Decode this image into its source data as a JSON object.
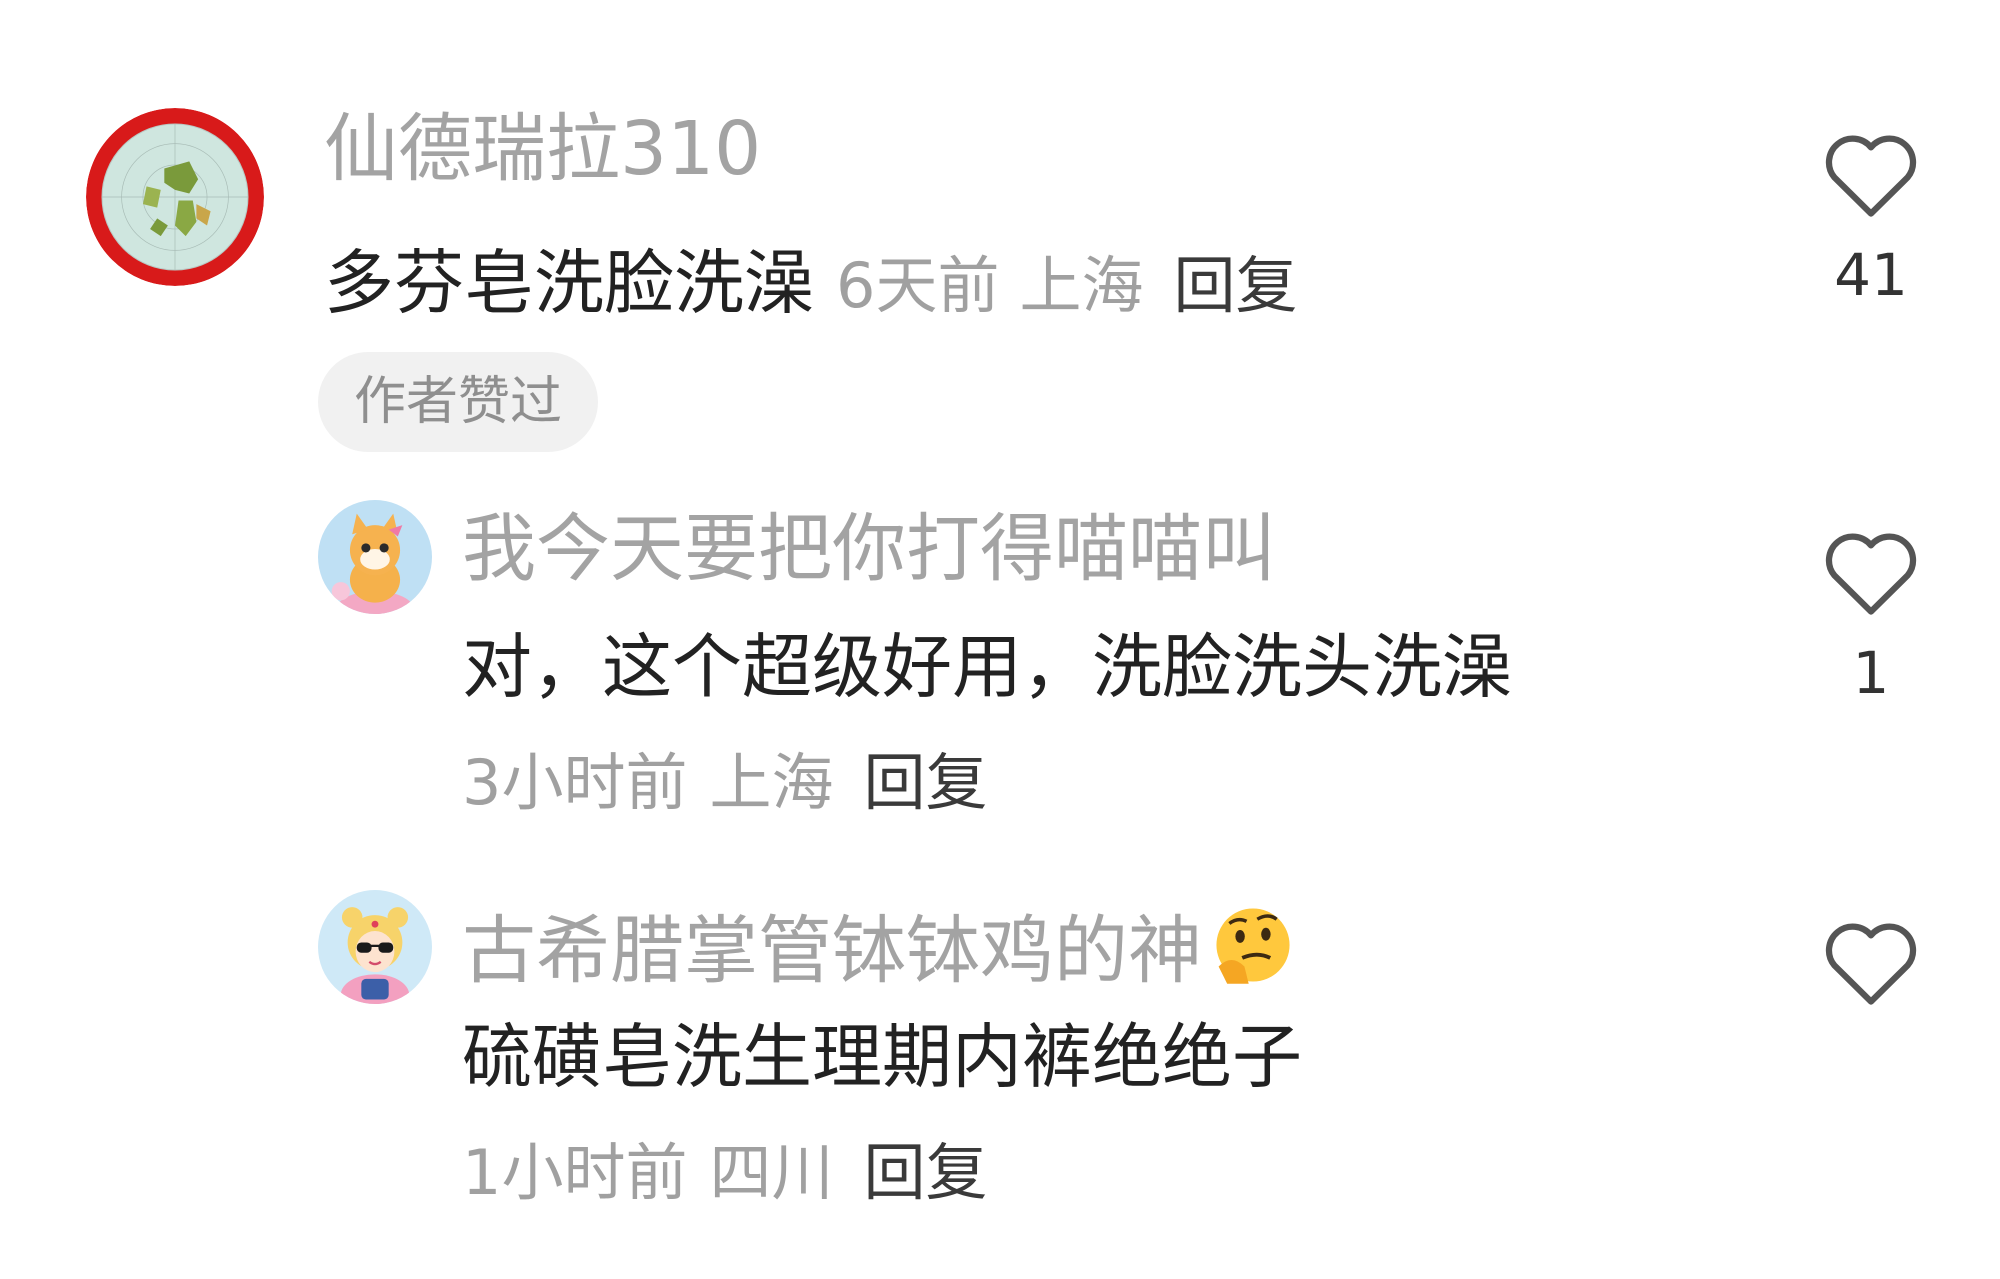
{
  "comments": [
    {
      "username": "仙德瑞拉310",
      "text": "多芬皂洗脸洗澡",
      "time": "6天前",
      "location": "上海",
      "reply_label": "回复",
      "badge": "作者赞过",
      "likes": "41",
      "avatar": "flat-earth-map-icon"
    }
  ],
  "replies": [
    {
      "username": "我今天要把你打得喵喵叫",
      "text": "对，这个超级好用，洗脸洗头洗澡",
      "time": "3小时前",
      "location": "上海",
      "reply_label": "回复",
      "likes": "1",
      "avatar": "cartoon-cat-icon"
    },
    {
      "username": "古希腊掌管钵钵鸡的神",
      "username_emoji": "thinking-face-emoji",
      "text": "硫磺皂洗生理期内裤绝绝子",
      "time": "1小时前",
      "location": "四川",
      "reply_label": "回复",
      "likes": "",
      "avatar": "sailor-moon-girl-icon"
    }
  ],
  "colors": {
    "username": "#a3a3a3",
    "body": "#222222",
    "meta": "#a0a0a0",
    "reply": "#3a3a3a",
    "badge_bg": "#f1f1f1",
    "heart_stroke": "#555555"
  }
}
